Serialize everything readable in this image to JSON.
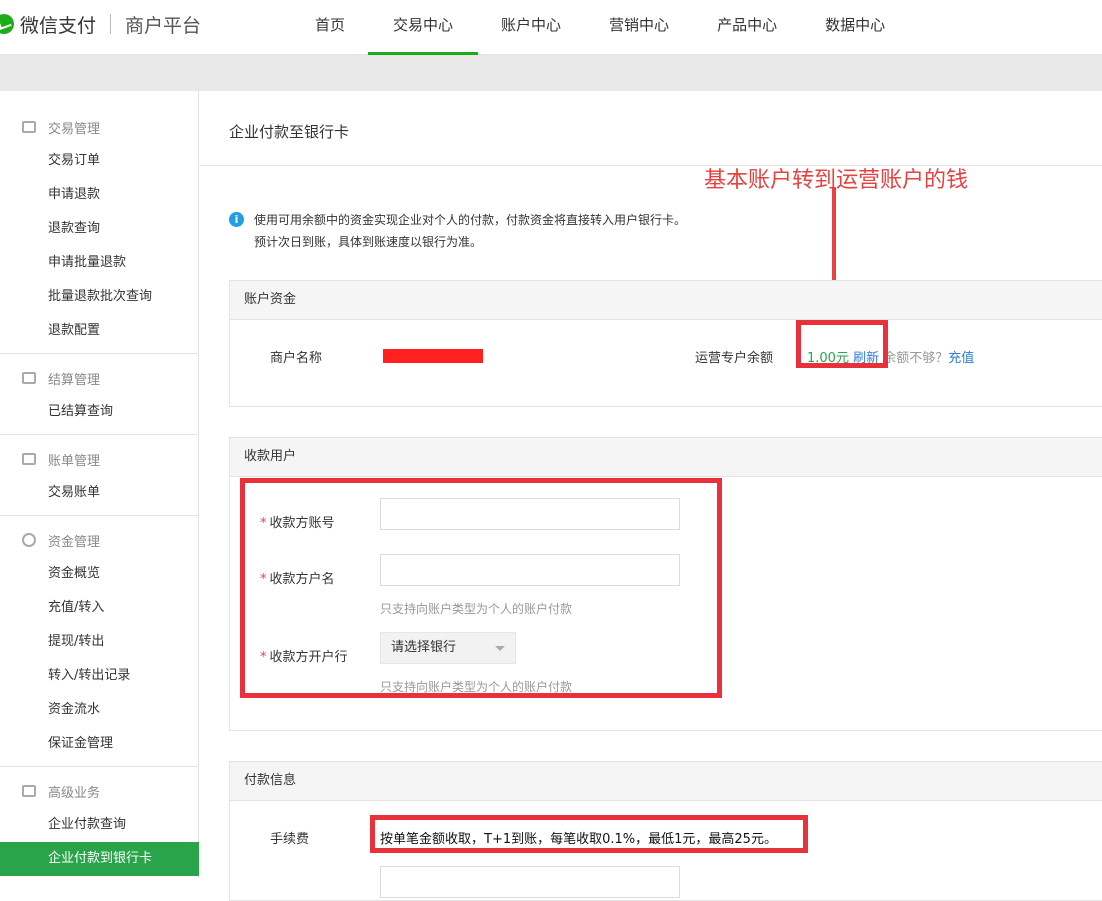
{
  "header": {
    "brand": "微信支付",
    "subtitle": "商户平台",
    "nav": [
      {
        "label": "首页"
      },
      {
        "label": "交易中心"
      },
      {
        "label": "账户中心"
      },
      {
        "label": "营销中心"
      },
      {
        "label": "产品中心"
      },
      {
        "label": "数据中心"
      }
    ],
    "active_nav": "交易中心"
  },
  "sidebar": {
    "groups": [
      {
        "title": "交易管理",
        "icon": "card-icon",
        "items": [
          "交易订单",
          "申请退款",
          "退款查询",
          "申请批量退款",
          "批量退款批次查询",
          "退款配置"
        ]
      },
      {
        "title": "结算管理",
        "icon": "calculator-icon",
        "items": [
          "已结算查询"
        ]
      },
      {
        "title": "账单管理",
        "icon": "yen-icon",
        "items": [
          "交易账单"
        ]
      },
      {
        "title": "资金管理",
        "icon": "money-bag-icon",
        "items": [
          "资金概览",
          "充值/转入",
          "提现/转出",
          "转入/转出记录",
          "资金流水",
          "保证金管理"
        ]
      },
      {
        "title": "高级业务",
        "icon": "layers-icon",
        "items": [
          "企业付款查询",
          "企业付款到银行卡"
        ]
      }
    ],
    "active_item": "企业付款到银行卡"
  },
  "main": {
    "title": "企业付款至银行卡",
    "annotation": "基本账户转到运营账户的钱",
    "notice": {
      "line1": "使用可用余额中的资金实现企业对个人的付款，付款资金将直接转入用户银行卡。",
      "line2": "预计次日到账，具体到账速度以银行为准。"
    },
    "account_panel": {
      "header": "账户资金",
      "merchant_label": "商户名称",
      "balance_label": "运营专户余额",
      "balance_amount": "1.00元",
      "refresh_link": "刷新",
      "insufficient_text": "余额不够？",
      "recharge_link": "充值"
    },
    "payee_panel": {
      "header": "收款用户",
      "account_label": "收款方账号",
      "name_label": "收款方户名",
      "name_hint": "只支持向账户类型为个人的账户付款",
      "bank_label": "收款方开户行",
      "bank_placeholder": "请选择银行",
      "bank_hint": "只支持向账户类型为个人的账户付款",
      "account_value": "",
      "name_value": ""
    },
    "payment_panel": {
      "header": "付款信息",
      "fee_label": "手续费",
      "fee_text": "按单笔金额收取，T+1到账，每笔收取0.1%，最低1元，最高25元。"
    },
    "colors": {
      "brand_green": "#1aad19",
      "active_green": "#2aa44a",
      "annotation_red": "#e8413f",
      "link_blue": "#2a7ed8"
    }
  }
}
